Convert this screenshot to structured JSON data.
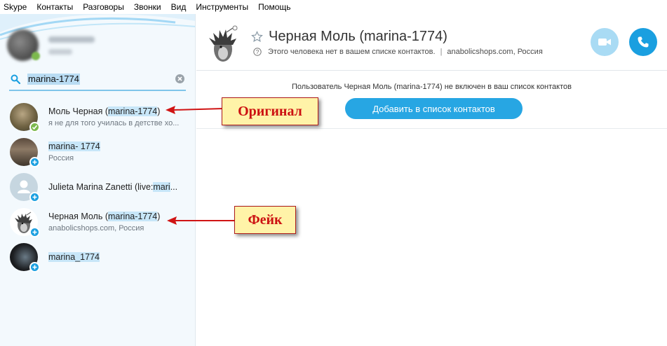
{
  "menu": [
    "Skype",
    "Контакты",
    "Разговоры",
    "Звонки",
    "Вид",
    "Инструменты",
    "Помощь"
  ],
  "search": {
    "value": "marina-1774"
  },
  "contacts": [
    {
      "pre": "Моль Черная (",
      "hl": "marina-1774",
      "post": ")",
      "sub": "я не для того училась в детстве хо...",
      "badge": "online"
    },
    {
      "pre": "",
      "hl": "marina- 1774",
      "post": "",
      "sub": "Россия",
      "badge": "add"
    },
    {
      "pre": "Julieta Marina Zanetti (live:",
      "hl": "mari",
      "post": "...",
      "sub": "",
      "badge": "add"
    },
    {
      "pre": "Черная Моль (",
      "hl": "marina-1774",
      "post": ")",
      "sub": "anabolicshops.com, Россия",
      "badge": "add"
    },
    {
      "pre": "",
      "hl": "marina_1774",
      "post": "",
      "sub": "",
      "badge": "add"
    }
  ],
  "header": {
    "title": "Черная Моль (marina-1774)",
    "subtitle_note": "Этого человека нет в вашем списке контактов.",
    "subtitle_sep": "|",
    "subtitle_location": "anabolicshops.com, Россия"
  },
  "notice": {
    "message": "Пользователь Черная Моль (marina-1774) не включен в ваш список контактов",
    "add_button": "Добавить в список контактов"
  },
  "annotations": {
    "original": "Оригинал",
    "fake": "Фейк"
  },
  "colors": {
    "accent": "#1a9fe0",
    "annotation_text": "#cc1111",
    "annotation_bg": "#fff3a8",
    "online": "#7cb94d"
  }
}
